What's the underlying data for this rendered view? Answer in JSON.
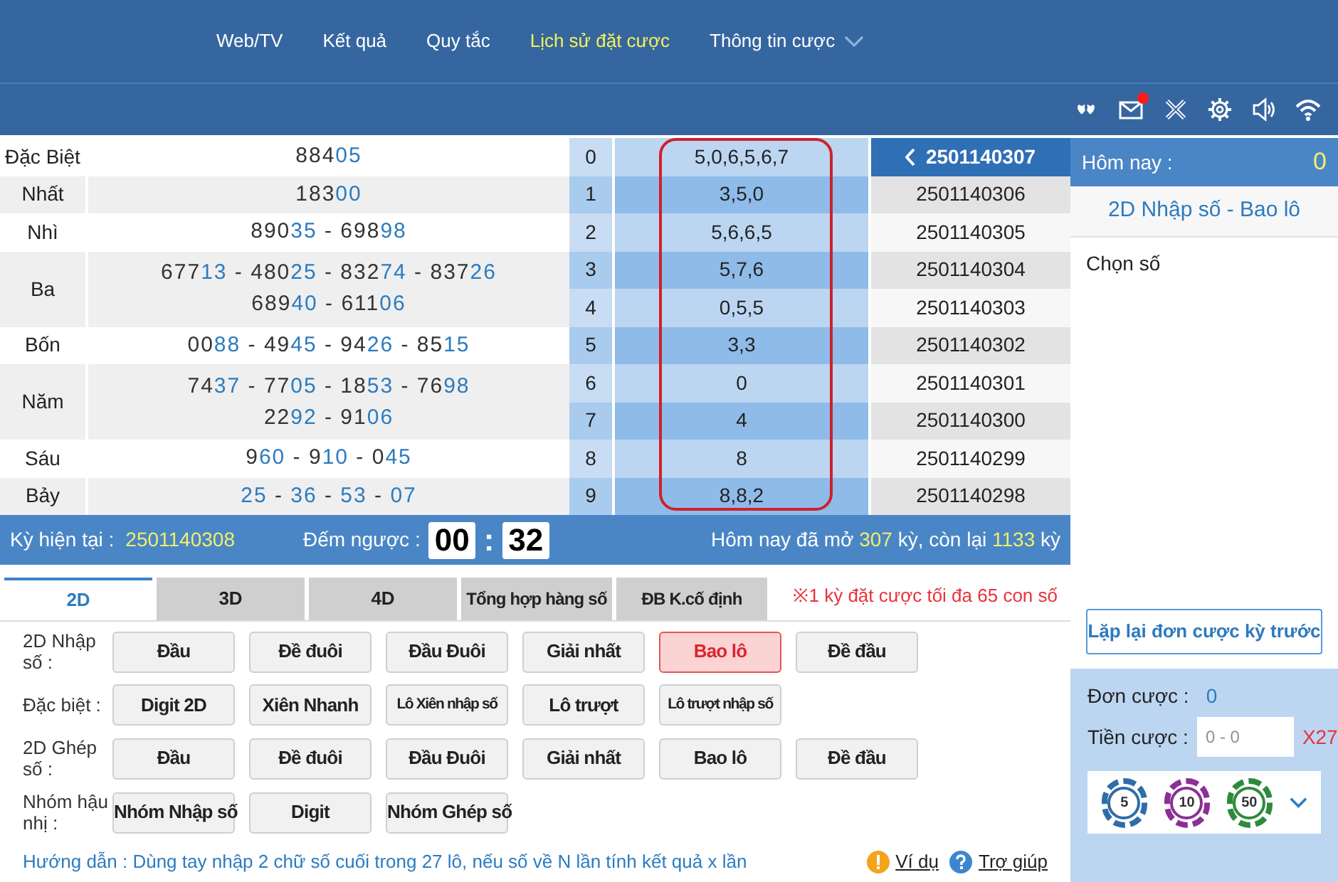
{
  "nav": [
    {
      "label": "Web/TV",
      "selected": false,
      "has_menu": false
    },
    {
      "label": "Kết quả",
      "selected": false,
      "has_menu": false
    },
    {
      "label": "Quy tắc",
      "selected": false,
      "has_menu": false
    },
    {
      "label": "Lịch sử đặt cược",
      "selected": true,
      "has_menu": false
    },
    {
      "label": "Thông tin cược",
      "selected": false,
      "has_menu": true
    }
  ],
  "toolbar_icons": [
    {
      "kind": "hearts"
    },
    {
      "kind": "mail",
      "badge": true
    },
    {
      "kind": "tools"
    },
    {
      "kind": "gear"
    },
    {
      "kind": "speaker"
    },
    {
      "kind": "wifi"
    }
  ],
  "results": [
    {
      "prize": "Đặc Biệt",
      "lines": [
        [
          {
            "head": "884",
            "tail": "05"
          }
        ]
      ]
    },
    {
      "prize": "Nhất",
      "lines": [
        [
          {
            "head": "183",
            "tail": "00"
          }
        ]
      ]
    },
    {
      "prize": "Nhì",
      "lines": [
        [
          {
            "head": "890",
            "tail": "35"
          },
          {
            "head": "698",
            "tail": "98"
          }
        ]
      ]
    },
    {
      "prize": "Ba",
      "lines": [
        [
          {
            "head": "677",
            "tail": "13"
          },
          {
            "head": "480",
            "tail": "25"
          },
          {
            "head": "832",
            "tail": "74"
          },
          {
            "head": "837",
            "tail": "26"
          }
        ],
        [
          {
            "head": "689",
            "tail": "40"
          },
          {
            "head": "611",
            "tail": "06"
          }
        ]
      ]
    },
    {
      "prize": "Bốn",
      "lines": [
        [
          {
            "head": "00",
            "tail": "88"
          },
          {
            "head": "49",
            "tail": "45"
          },
          {
            "head": "94",
            "tail": "26"
          },
          {
            "head": "85",
            "tail": "15"
          }
        ]
      ]
    },
    {
      "prize": "Năm",
      "lines": [
        [
          {
            "head": "74",
            "tail": "37"
          },
          {
            "head": "77",
            "tail": "05"
          },
          {
            "head": "18",
            "tail": "53"
          },
          {
            "head": "76",
            "tail": "98"
          }
        ],
        [
          {
            "head": "22",
            "tail": "92"
          },
          {
            "head": "91",
            "tail": "06"
          }
        ]
      ]
    },
    {
      "prize": "Sáu",
      "lines": [
        [
          {
            "head": "9",
            "tail": "60"
          },
          {
            "head": "9",
            "tail": "10"
          },
          {
            "head": "0",
            "tail": "45"
          }
        ]
      ]
    },
    {
      "prize": "Bảy",
      "lines": [
        [
          {
            "tail": "25"
          },
          {
            "tail": "36"
          },
          {
            "tail": "53"
          },
          {
            "tail": "07"
          }
        ]
      ]
    }
  ],
  "number_separator": "-",
  "digits": [
    {
      "index": "0",
      "values": "5,0,6,5,6,7"
    },
    {
      "index": "1",
      "values": "3,5,0"
    },
    {
      "index": "2",
      "values": "5,6,6,5"
    },
    {
      "index": "3",
      "values": "5,7,6"
    },
    {
      "index": "4",
      "values": "0,5,5"
    },
    {
      "index": "5",
      "values": "3,3"
    },
    {
      "index": "6",
      "values": "0"
    },
    {
      "index": "7",
      "values": "4"
    },
    {
      "index": "8",
      "values": "8"
    },
    {
      "index": "9",
      "values": "8,8,2"
    }
  ],
  "periods": [
    {
      "label": "2501140307",
      "selected": true
    },
    {
      "label": "2501140306",
      "selected": false
    },
    {
      "label": "2501140305",
      "selected": false
    },
    {
      "label": "2501140304",
      "selected": false
    },
    {
      "label": "2501140303",
      "selected": false
    },
    {
      "label": "2501140302",
      "selected": false
    },
    {
      "label": "2501140301",
      "selected": false
    },
    {
      "label": "2501140300",
      "selected": false
    },
    {
      "label": "2501140299",
      "selected": false
    },
    {
      "label": "2501140298",
      "selected": false
    }
  ],
  "status_bar": {
    "current_label": "Kỳ hiện tại  :",
    "current_value": "2501140308",
    "countdown_label": "Đếm ngược :",
    "minutes": "00",
    "separator": ":",
    "seconds": "32",
    "summary": [
      {
        "text": "Hôm nay đã mở ",
        "kind": "text"
      },
      {
        "text": "307",
        "kind": "count"
      },
      {
        "text": " kỳ, còn lại ",
        "kind": "text"
      },
      {
        "text": "1133",
        "kind": "count"
      },
      {
        "text": " kỳ",
        "kind": "text"
      }
    ]
  },
  "tabs": [
    {
      "label": "2D",
      "selected": true
    },
    {
      "label": "3D",
      "selected": false
    },
    {
      "label": "4D",
      "selected": false
    },
    {
      "label": "Tổng hợp hàng số",
      "selected": false
    },
    {
      "label": "ĐB K.cố định",
      "selected": false
    }
  ],
  "notice": "※1 kỳ đặt cược tối đa 65 con số",
  "bet_groups": [
    {
      "label": "2D Nhập số :",
      "options": [
        {
          "label": "Đầu",
          "selected": false
        },
        {
          "label": "Đề đuôi",
          "selected": false
        },
        {
          "label": "Đầu Đuôi",
          "selected": false
        },
        {
          "label": "Giải nhất",
          "selected": false
        },
        {
          "label": "Bao lô",
          "selected": true
        },
        {
          "label": "Đề đầu",
          "selected": false
        }
      ]
    },
    {
      "label": "Đặc biệt :",
      "options": [
        {
          "label": "Digit 2D",
          "selected": false
        },
        {
          "label": "Xiên Nhanh",
          "selected": false
        },
        {
          "label": "Lô Xiên nhập số",
          "selected": false
        },
        {
          "label": "Lô trượt",
          "selected": false
        },
        {
          "label": "Lô trượt nhập số",
          "selected": false
        }
      ]
    },
    {
      "label": "2D Ghép số :",
      "options": [
        {
          "label": "Đầu",
          "selected": false
        },
        {
          "label": "Đề đuôi",
          "selected": false
        },
        {
          "label": "Đầu Đuôi",
          "selected": false
        },
        {
          "label": "Giải nhất",
          "selected": false
        },
        {
          "label": "Bao lô",
          "selected": false
        },
        {
          "label": "Đề đầu",
          "selected": false
        }
      ]
    },
    {
      "label": "Nhóm hậu nhị :",
      "options": [
        {
          "label": "Nhóm Nhập số",
          "selected": false
        },
        {
          "label": "Digit",
          "selected": false
        },
        {
          "label": "Nhóm Ghép số",
          "selected": false
        }
      ]
    }
  ],
  "guide": "Hướng dẫn : Dùng tay nhập 2 chữ số cuối trong 27 lô, nếu số về N lần tính kết quả x lần",
  "help_links": [
    {
      "label": "Ví dụ",
      "kind": "warning"
    },
    {
      "label": "Trợ giúp",
      "kind": "question"
    }
  ],
  "side_panel": {
    "today_label": "Hôm nay :",
    "today_value": "0",
    "bet_type": "2D Nhập số - Bao lô",
    "choose_label": "Chọn số",
    "repeat_button": "Lặp lại đơn cược kỳ trước",
    "order_label": "Đơn cược :",
    "order_value": "0",
    "amount_label": "Tiền cược :",
    "amount_placeholder": "0 - 0",
    "multiplier": "X27",
    "chips": [
      {
        "label": "5",
        "color": "#2e6da8"
      },
      {
        "label": "10",
        "color": "#8b2f96"
      },
      {
        "label": "50",
        "color": "#2f8a3c"
      }
    ]
  }
}
